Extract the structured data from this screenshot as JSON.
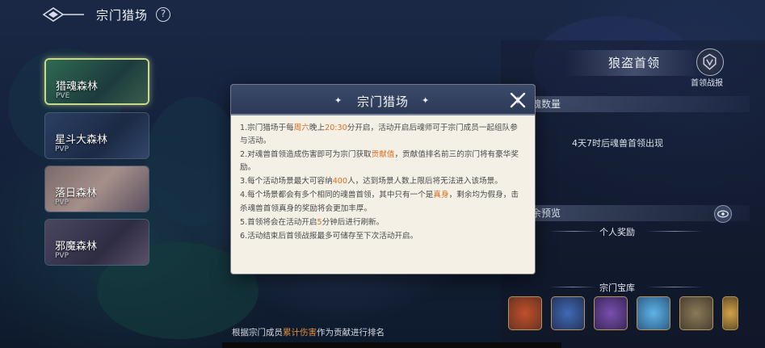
{
  "header": {
    "title": "宗门猎场",
    "help_label": "?"
  },
  "maps": [
    {
      "name": "猎魂森林",
      "tag": "PVE",
      "active": true
    },
    {
      "name": "星斗大森林",
      "tag": "PVP",
      "active": false
    },
    {
      "name": "落日森林",
      "tag": "PVP",
      "active": false
    },
    {
      "name": "邪魔森林",
      "tag": "PVP",
      "active": false
    }
  ],
  "right_panel": {
    "boss_title": "狼盗首领",
    "boss_report_label": "首领战报",
    "section_count": "魂数量",
    "spawn_text": "4天7时后魂兽首领出现",
    "section_preview": "余预览",
    "personal_reward": "个人奖励",
    "sect_treasury": "宗门宝库"
  },
  "bottom_note": {
    "prefix": "根据宗门成员",
    "highlight": "累计伤害",
    "suffix": "作为贡献进行排名"
  },
  "dialog": {
    "title": "宗门猎场",
    "rules": [
      [
        {
          "t": "1.宗门猎场于每",
          "h": false
        },
        {
          "t": "周六",
          "h": true
        },
        {
          "t": "晚上",
          "h": false
        },
        {
          "t": "20:30",
          "h": true
        },
        {
          "t": "分开启，活动开启后魂师可于宗门成员一起组队参与活动。",
          "h": false
        }
      ],
      [
        {
          "t": "2.对魂兽首领造成伤害即可为宗门获取",
          "h": false
        },
        {
          "t": "贡献值",
          "h": true
        },
        {
          "t": "，贡献值排名前三的宗门将有豪华奖励。",
          "h": false
        }
      ],
      [
        {
          "t": "3.每个活动场景最大可容纳",
          "h": false
        },
        {
          "t": "400",
          "h": true
        },
        {
          "t": "人，达到场景人数上限后将无法进入该场景。",
          "h": false
        }
      ],
      [
        {
          "t": "4.每个场景都会有多个相同的魂兽首领，其中只有一个是",
          "h": false
        },
        {
          "t": "真身",
          "h": true
        },
        {
          "t": "，剩余均为假身，击杀魂兽首领真身的奖励将会更加丰厚。",
          "h": false
        }
      ],
      [
        {
          "t": "5.首领将会在活动开启",
          "h": false
        },
        {
          "t": "5",
          "h": true
        },
        {
          "t": "分钟后进行刷新。",
          "h": false
        }
      ],
      [
        {
          "t": "6.活动结束后首领战报最多可储存至下次活动开启。",
          "h": false
        }
      ]
    ]
  },
  "colors": {
    "highlight": "#d96e1e",
    "dialog_bg": "#f4f0e6",
    "dialog_header": "#2c3a57"
  }
}
